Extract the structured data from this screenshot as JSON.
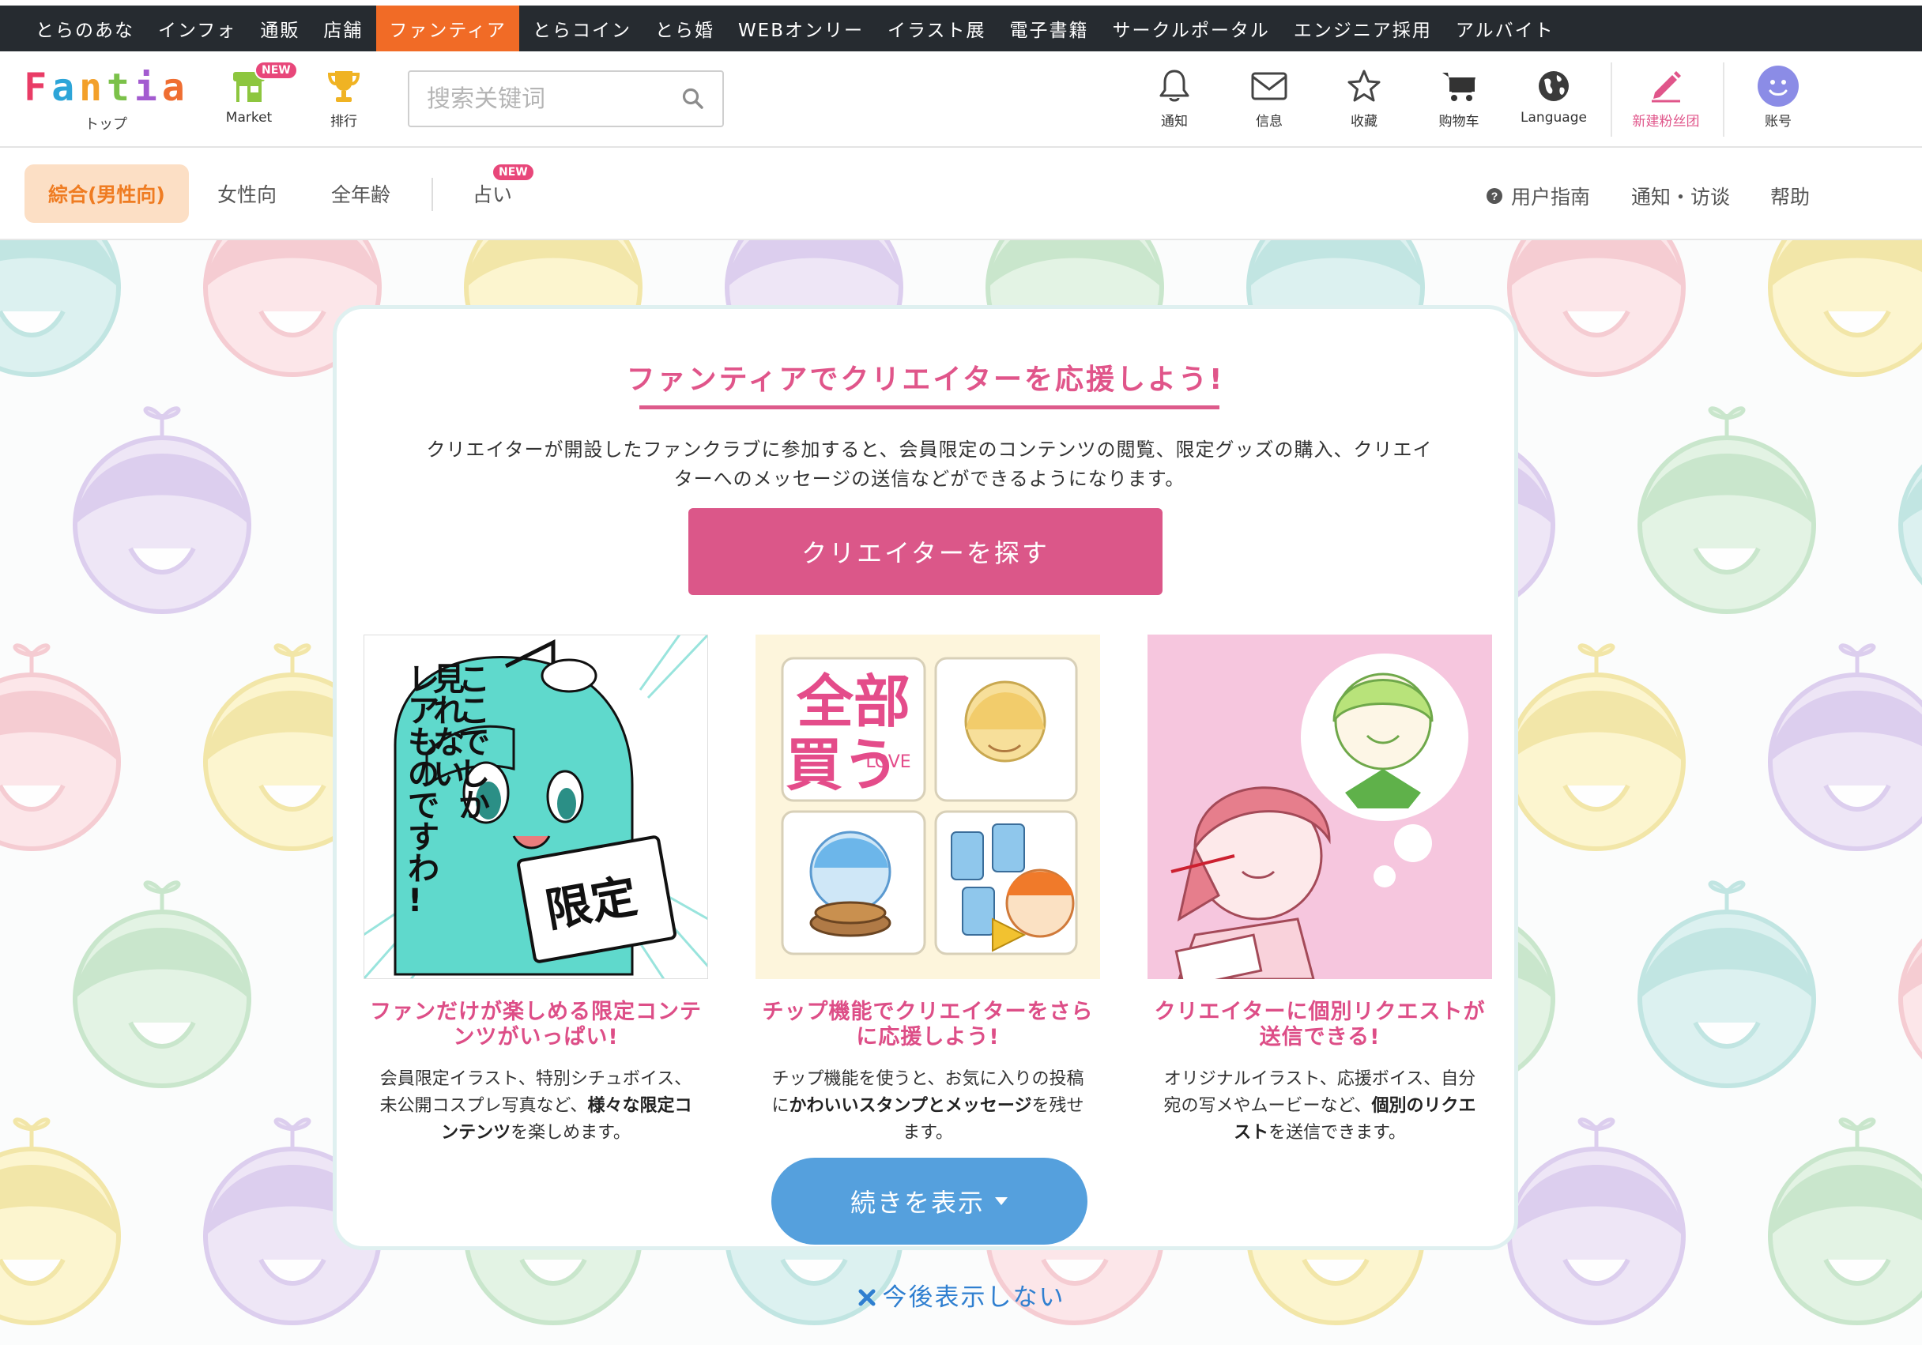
{
  "topbar": {
    "items": [
      "とらのあな",
      "インフォ",
      "通販",
      "店舗",
      "ファンティア",
      "とらコイン",
      "とら婚",
      "WEBオンリー",
      "イラスト展",
      "電子書籍",
      "サークルポータル",
      "エンジニア採用",
      "アルバイト"
    ],
    "active_index": 4
  },
  "header": {
    "logo_text": "Fantia",
    "logo_chars": [
      "F",
      "a",
      "n",
      "t",
      "i",
      "a"
    ],
    "home_label": "トップ",
    "market_label": "Market",
    "ranking_label": "排行",
    "new_badge": "NEW",
    "search_placeholder": "搜索关键词",
    "nav": {
      "notification": "通知",
      "messages": "信息",
      "favorites": "收藏",
      "cart": "购物车",
      "language": "Language",
      "new_fanclub": "新建粉丝团",
      "account": "账号"
    },
    "icons": [
      "bell-icon",
      "envelope-icon",
      "star-icon",
      "cart-icon",
      "globe-icon",
      "pencil-icon",
      "avatar-icon",
      "search-icon",
      "shop-icon",
      "trophy-icon"
    ]
  },
  "categories": {
    "items": [
      "綜合(男性向)",
      "女性向",
      "全年齢",
      "占い"
    ],
    "active_index": 0,
    "fortune_badge": "NEW",
    "links": {
      "guide": "用户指南",
      "notice": "通知・访谈",
      "help": "帮助"
    }
  },
  "card": {
    "title": "ファンティアでクリエイターを応援しよう!",
    "description_line1": "クリエイターが開設したファンクラブに参加すると、会員限定のコンテンツの閲覧、限定グッズの購入、クリエイ",
    "description_line2": "ターへのメッセージの送信などができるようになります。",
    "cta_label": "クリエイターを探す",
    "features": [
      {
        "title_line1": "ファンだけが楽しめる限定コンテ",
        "title_line2": "ンツがいっぱい!",
        "desc_parts": [
          "会員限定イラスト、特別シチュボイス、",
          "未公開コスプレ写真など、",
          "様々な限定コ",
          "ンテンツ",
          "を楽しめます。"
        ],
        "thumb_text": [
          "ここでしか",
          "見れない",
          "レアものですわ!"
        ],
        "sign_text": "限定"
      },
      {
        "title_line1": "チップ機能でクリエイターをさら",
        "title_line2": "に応援しよう!",
        "desc_parts": [
          "チップ機能を使うと、お気に入りの投稿",
          "に",
          "かわいいスタンプとメッセージ",
          "を残せ",
          "ます。"
        ],
        "stamp_text": "全部買う",
        "stamp_small": "LOVE"
      },
      {
        "title_line1": "クリエイターに個別リクエストが",
        "title_line2": "送信できる!",
        "desc_parts": [
          "オリジナルイラスト、応援ボイス、自分",
          "宛の写メやムービーなど、",
          "個別のリクエ",
          "スト",
          "を送信できます。"
        ]
      }
    ],
    "more_label": "続きを表示",
    "dismiss_label": "今後表示しない"
  },
  "colors": {
    "topbar_bg": "#262b30",
    "topbar_active": "#f16b26",
    "category_active_bg": "#fcdfc5",
    "category_active_text": "#ef7c22",
    "brand_pink": "#db5789",
    "more_blue": "#55a0dd",
    "dismiss_blue": "#2f7fd0"
  }
}
